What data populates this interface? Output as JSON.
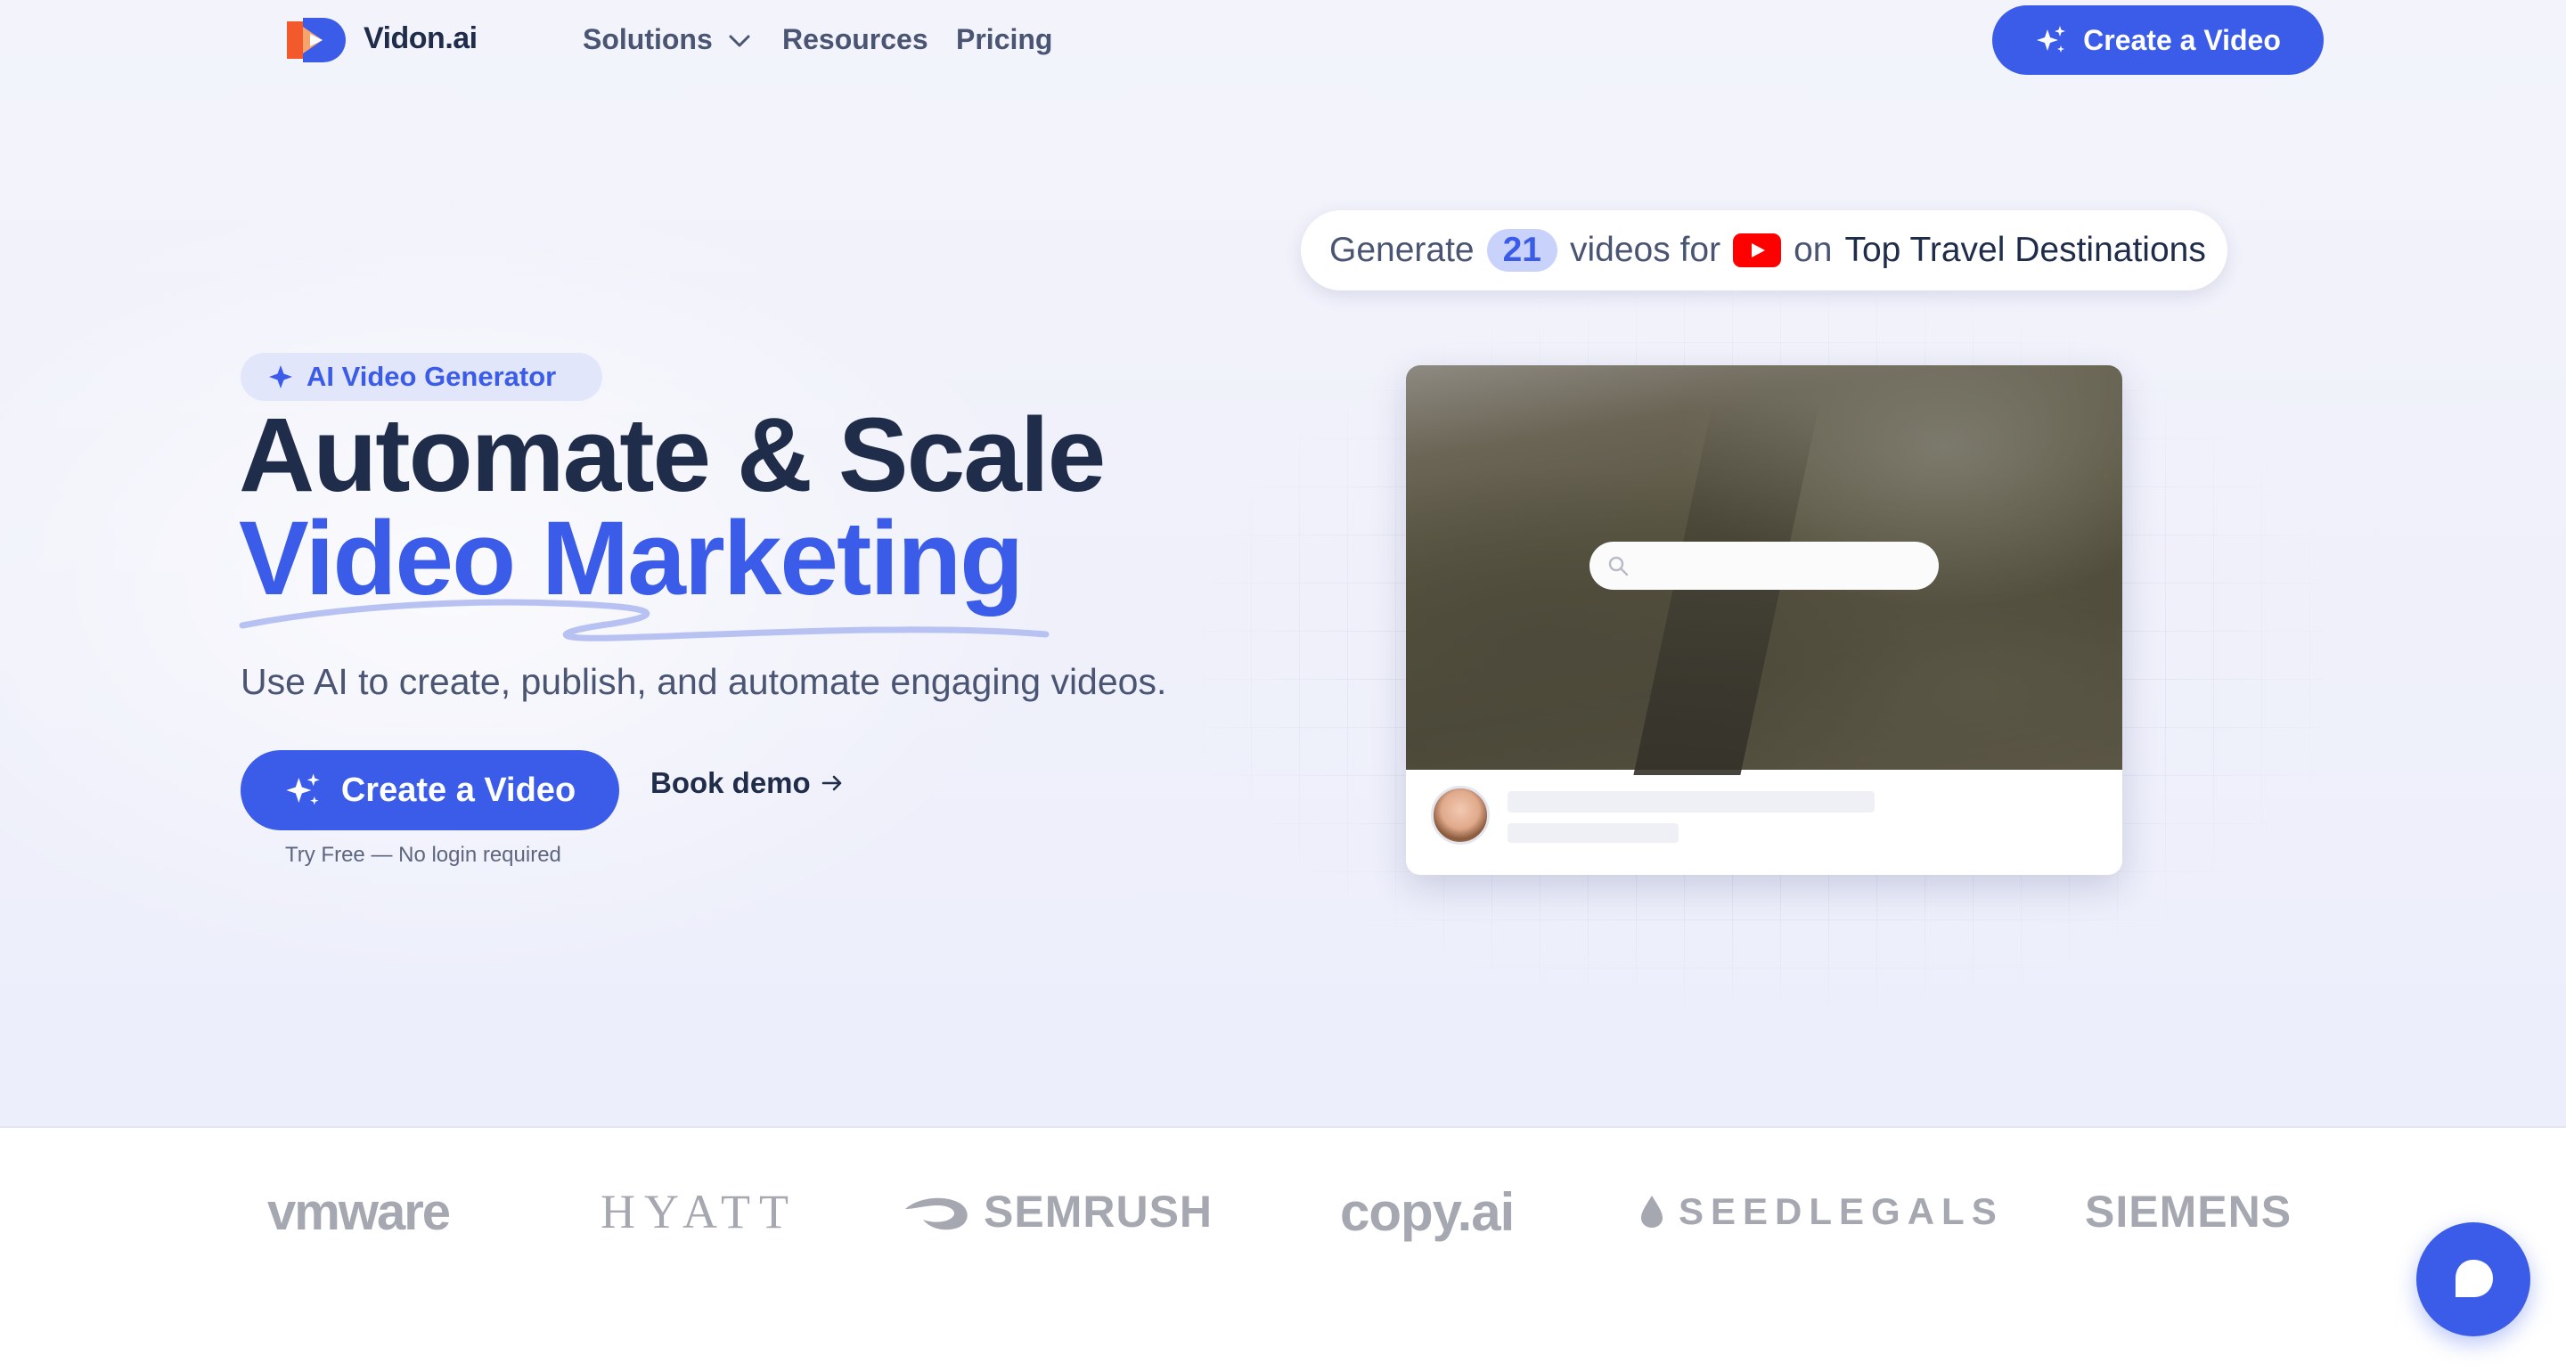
{
  "colors": {
    "accent": "#3a5ce9",
    "heading": "#1f2d4a",
    "muted": "#4a5573",
    "logo_gray": "#a5a8b0"
  },
  "nav": {
    "brand": "Vidon.ai",
    "solutions": "Solutions",
    "resources": "Resources",
    "pricing": "Pricing",
    "cta": "Create a Video"
  },
  "hero": {
    "badge": "AI Video Generator",
    "headline_line1": "Automate & Scale",
    "headline_line2": "Video Marketing",
    "subtitle": "Use AI to create, publish, and automate engaging videos.",
    "cta": "Create a Video",
    "demo": "Book demo",
    "note": "Try Free — No login required"
  },
  "generator": {
    "prefix": "Generate",
    "count": "21",
    "middle": "videos for",
    "platform_icon": "youtube-icon",
    "on": "on",
    "topic": "Top Travel Destinations"
  },
  "logos": {
    "vmware": "vmware",
    "hyatt": "HYATT",
    "semrush": "SEMRUSH",
    "copyai": "copy.ai",
    "seedlegals": "SEEDLEGALS",
    "siemens": "SIEMENS"
  },
  "icons": {
    "logo": "vidon-logo-icon",
    "chevron": "chevron-down-icon",
    "sparkle": "sparkle-icon",
    "arrow": "arrow-right-icon",
    "search": "search-icon",
    "chat": "chat-bubble-icon"
  }
}
